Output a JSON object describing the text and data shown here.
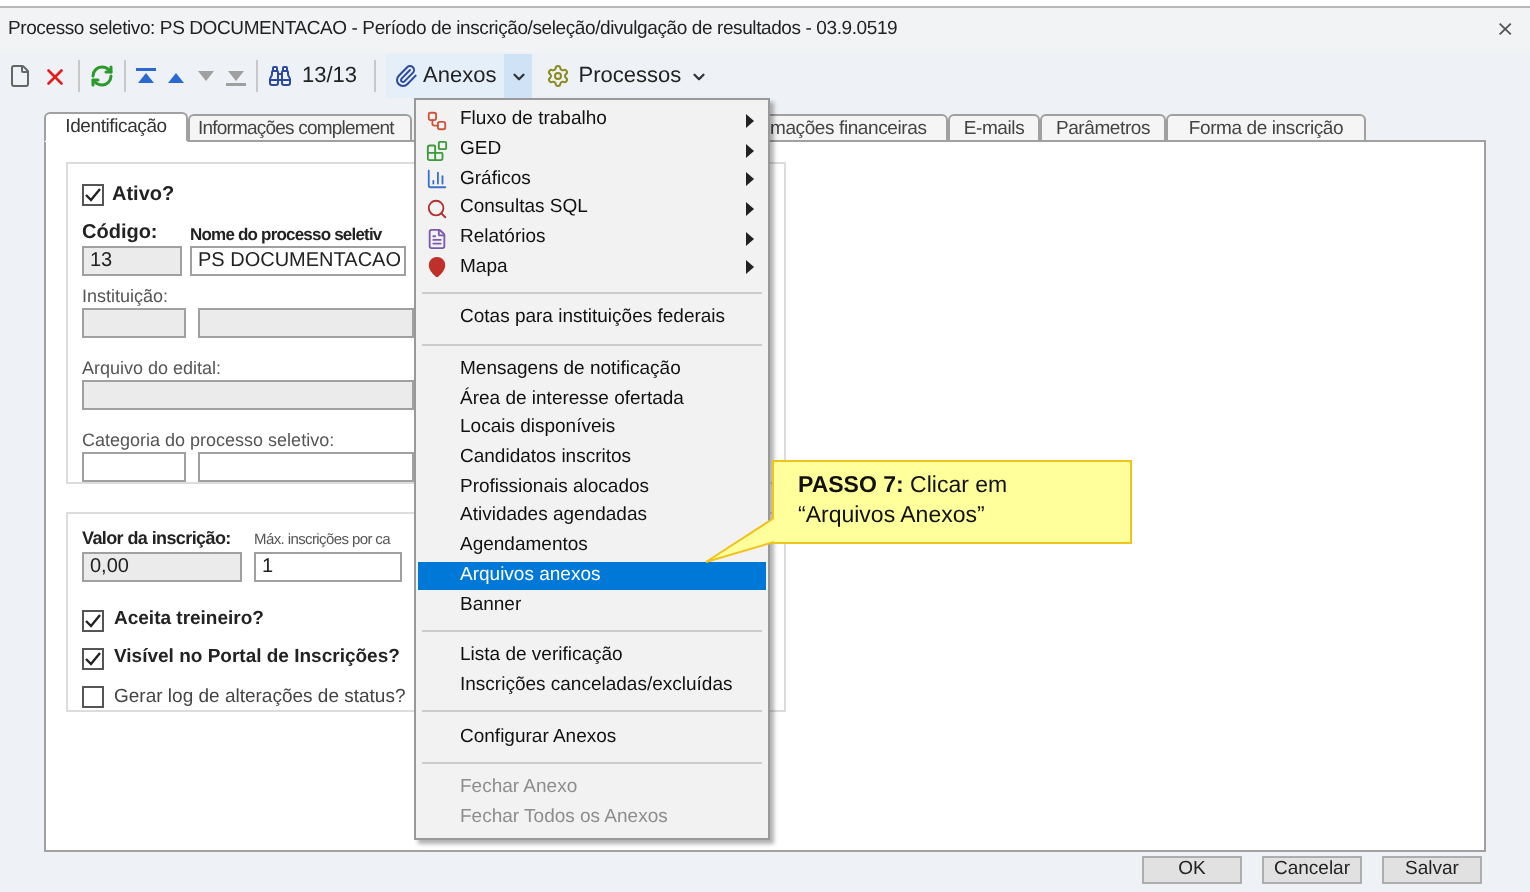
{
  "window": {
    "title": "Processo seletivo: PS DOCUMENTACAO - Período de inscrição/seleção/divulgação de resultados - 03.9.0519",
    "close": "⨯"
  },
  "toolbar": {
    "counter": "13/13",
    "anexos": {
      "label": "Anexos",
      "pressed": true
    },
    "processos": {
      "label": "Processos"
    }
  },
  "tabs": [
    {
      "label": "Identificação",
      "selected": true
    },
    {
      "label": "Informações complement",
      "selected": false
    },
    {
      "label": "mações financeiras",
      "selected": false
    },
    {
      "label": "E-mails",
      "selected": false
    },
    {
      "label": "Parâmetros",
      "selected": false
    },
    {
      "label": "Forma de inscrição",
      "selected": false
    }
  ],
  "form": {
    "ativo": {
      "label": "Ativo?",
      "checked": true
    },
    "codigo": {
      "label": "Código:",
      "value": "13"
    },
    "nome": {
      "label": "Nome do processo seletiv",
      "value": "PS DOCUMENTACAO"
    },
    "instituicao": {
      "label": "Instituição:"
    },
    "arquivo": {
      "label": "Arquivo do edital:"
    },
    "categoria": {
      "label": "Categoria do processo seletivo:"
    },
    "valor": {
      "label": "Valor da inscrição:",
      "value": "0,00"
    },
    "maximo": {
      "label": "Máx. inscrições por ca",
      "value": "1"
    },
    "checks": [
      {
        "label": "Aceita treineiro?",
        "checked": true,
        "bold": true
      },
      {
        "label": "Visível no Portal de Inscrições?",
        "checked": true,
        "bold": true
      },
      {
        "label": "Gerar log de alterações de status?",
        "checked": false,
        "bold": false
      }
    ]
  },
  "menu": [
    {
      "kind": "submenu",
      "label": "Fluxo de trabalho",
      "selected": false,
      "disabled": false
    },
    {
      "kind": "submenu",
      "label": "GED",
      "selected": false,
      "disabled": false
    },
    {
      "kind": "submenu",
      "label": "Gráficos",
      "selected": false,
      "disabled": false
    },
    {
      "kind": "submenu",
      "label": "Consultas SQL",
      "selected": false,
      "disabled": false
    },
    {
      "kind": "submenu",
      "label": "Relatórios",
      "selected": false,
      "disabled": false
    },
    {
      "kind": "submenu",
      "label": "Mapa",
      "selected": false,
      "disabled": false
    },
    {
      "kind": "separator"
    },
    {
      "kind": "item",
      "label": "Cotas para instituições federais",
      "selected": false,
      "disabled": false
    },
    {
      "kind": "separator"
    },
    {
      "kind": "item",
      "label": "Mensagens de notificação",
      "selected": false,
      "disabled": false
    },
    {
      "kind": "item",
      "label": "Área de interesse ofertada",
      "selected": false,
      "disabled": false
    },
    {
      "kind": "item",
      "label": "Locais disponíveis",
      "selected": false,
      "disabled": false
    },
    {
      "kind": "item",
      "label": "Candidatos inscritos",
      "selected": false,
      "disabled": false
    },
    {
      "kind": "item",
      "label": "Profissionais alocados",
      "selected": false,
      "disabled": false
    },
    {
      "kind": "item",
      "label": "Atividades agendadas",
      "selected": false,
      "disabled": false
    },
    {
      "kind": "item",
      "label": "Agendamentos",
      "selected": false,
      "disabled": false
    },
    {
      "kind": "item",
      "label": "Arquivos anexos",
      "selected": true,
      "disabled": false
    },
    {
      "kind": "item",
      "label": "Banner",
      "selected": false,
      "disabled": false
    },
    {
      "kind": "separator"
    },
    {
      "kind": "item",
      "label": "Lista de verificação",
      "selected": false,
      "disabled": false
    },
    {
      "kind": "item",
      "label": "Inscrições canceladas/excluídas",
      "selected": false,
      "disabled": false
    },
    {
      "kind": "separator"
    },
    {
      "kind": "item",
      "label": "Configurar Anexos",
      "selected": false,
      "disabled": false
    },
    {
      "kind": "separator"
    },
    {
      "kind": "item",
      "label": "Fechar Anexo",
      "selected": false,
      "disabled": true
    },
    {
      "kind": "item",
      "label": "Fechar Todos os Anexos",
      "selected": false,
      "disabled": true
    }
  ],
  "callout": {
    "text": "**PASSO 7:** Clicar em “Arquivos Anexos”"
  },
  "buttons": [
    "OK",
    "Cancelar",
    "Salvar"
  ]
}
